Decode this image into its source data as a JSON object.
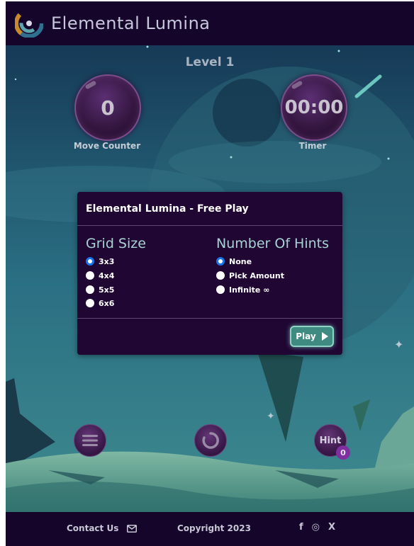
{
  "header": {
    "title": "Elemental Lumina",
    "logo_icon": "swirl-logo-icon"
  },
  "game": {
    "level": "Level 1",
    "move_counter": {
      "value": "0",
      "label": "Move Counter"
    },
    "timer": {
      "value": "00:00",
      "label": "Timer"
    }
  },
  "modal": {
    "title": "Elemental Lumina - Free Play",
    "grid_size": {
      "heading": "Grid Size",
      "options": [
        "3x3",
        "4x4",
        "5x5",
        "6x6"
      ],
      "selected": "3x3"
    },
    "hints": {
      "heading": "Number Of Hints",
      "options": [
        "None",
        "Pick Amount",
        "Infinite ∞"
      ],
      "selected": "None"
    },
    "play_label": "Play"
  },
  "controls": {
    "hint_label": "Hint",
    "hint_count": "0"
  },
  "footer": {
    "contact": "Contact Us",
    "copyright": "Copyright 2023",
    "social": [
      "f",
      "◎",
      "X"
    ]
  },
  "colors": {
    "header_bg": "#15052a",
    "modal_bg": "#1f0633",
    "accent_teal": "#3f8a81",
    "radio_selected": "#1a73e8"
  }
}
